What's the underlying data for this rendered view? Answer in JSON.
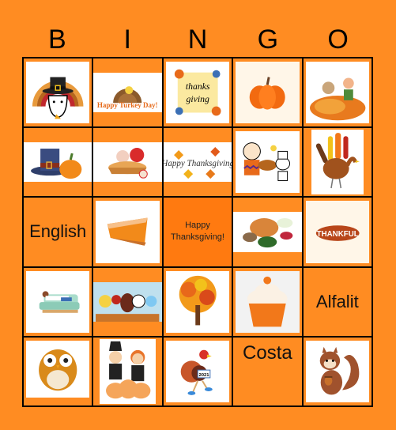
{
  "title": {
    "letters": [
      "B",
      "I",
      "N",
      "G",
      "O"
    ]
  },
  "colors": {
    "background": "#FF8C22",
    "free_space": "#FF7A10",
    "grid_line": "#000000"
  },
  "cells": [
    {
      "type": "image",
      "icon": "pilgrim-dog-turkey-icon"
    },
    {
      "type": "image",
      "icon": "happy-turkey-day-icon",
      "text": "Happy Turkey Day!"
    },
    {
      "type": "image",
      "icon": "thanksgiving-lettering-icon",
      "text": "thanks giving"
    },
    {
      "type": "image",
      "icon": "pumpkin-icon"
    },
    {
      "type": "image",
      "icon": "kid-dog-autumn-leaves-icon"
    },
    {
      "type": "image",
      "icon": "pilgrim-hat-pumpkin-icon"
    },
    {
      "type": "image",
      "icon": "apple-pie-icon"
    },
    {
      "type": "image",
      "icon": "happy-thanksgiving-leaves-icon",
      "text": "Happy Thanksgiving"
    },
    {
      "type": "image",
      "icon": "charlie-brown-snoopy-turkey-icon"
    },
    {
      "type": "image",
      "icon": "handprint-turkey-icon"
    },
    {
      "type": "text",
      "text": "English"
    },
    {
      "type": "image",
      "icon": "pumpkin-pie-slice-icon"
    },
    {
      "type": "free",
      "text": "Happy Thanksgiving!"
    },
    {
      "type": "image",
      "icon": "turkey-dinner-icon"
    },
    {
      "type": "image",
      "icon": "thankful-badge-icon",
      "text": "THANKFUL"
    },
    {
      "type": "image",
      "icon": "person-resting-couch-icon"
    },
    {
      "type": "image",
      "icon": "cartoon-parade-icon"
    },
    {
      "type": "image",
      "icon": "autumn-tree-icon"
    },
    {
      "type": "image",
      "icon": "pumpkin-cupcake-icon"
    },
    {
      "type": "text",
      "text": "Alfalit"
    },
    {
      "type": "image",
      "icon": "owl-icon"
    },
    {
      "type": "image",
      "icon": "pilgrim-kids-pumpkins-icon"
    },
    {
      "type": "image",
      "icon": "running-turkey-icon",
      "text": "2021"
    },
    {
      "type": "text",
      "text": "Costa"
    },
    {
      "type": "image",
      "icon": "squirrel-acorn-icon"
    }
  ]
}
